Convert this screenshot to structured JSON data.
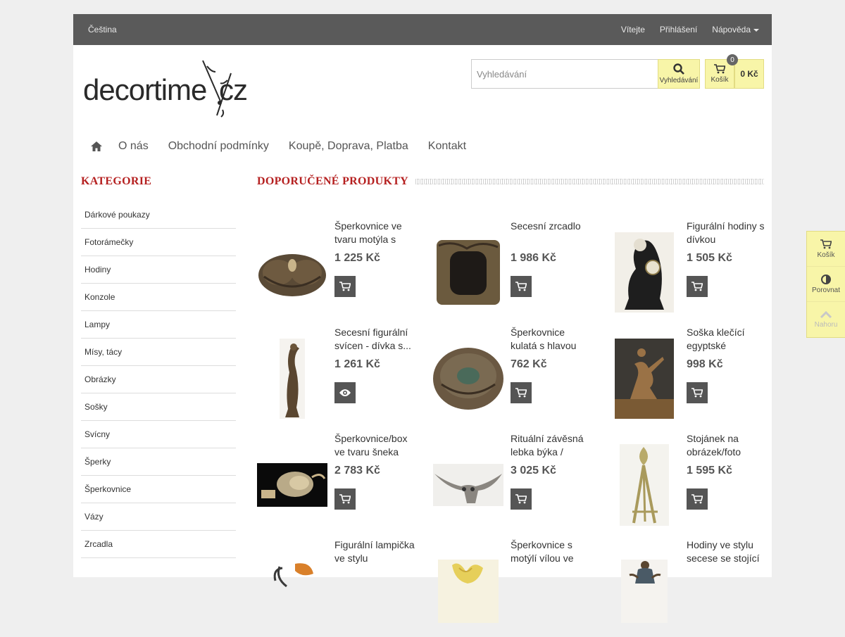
{
  "topbar": {
    "language": "Čeština",
    "welcome": "Vítejte",
    "login": "Přihlášení",
    "help": "Nápověda"
  },
  "logo": {
    "text": "decortime.cz"
  },
  "search": {
    "placeholder": "Vyhledávání",
    "button_label": "Vyhledávání"
  },
  "cart": {
    "label": "Košík",
    "count": "0",
    "total": "0 Kč"
  },
  "nav": {
    "items": [
      "O nás",
      "Obchodní podmínky",
      "Koupě, Doprava, Platba",
      "Kontakt"
    ]
  },
  "sidebar": {
    "title": "KATEGORIE",
    "items": [
      "Dárkové poukazy",
      "Fotorámečky",
      "Hodiny",
      "Konzole",
      "Lampy",
      "Mísy, tácy",
      "Obrázky",
      "Sošky",
      "Svícny",
      "Šperky",
      "Šperkovnice",
      "Vázy",
      "Zrcadla"
    ]
  },
  "main": {
    "title": "DOPORUČENÉ PRODUKTY",
    "products": [
      {
        "name": "Šperkovnice ve tvaru motýla s",
        "price": "1 225 Kč",
        "action": "cart-icon"
      },
      {
        "name": "Secesní zrcadlo",
        "price": "1 986 Kč",
        "action": "cart-icon"
      },
      {
        "name": "Figurální hodiny s dívkou",
        "price": "1 505 Kč",
        "action": "cart-icon"
      },
      {
        "name": "Secesní figurální svícen - dívka s...",
        "price": "1 261 Kč",
        "action": "eye-icon"
      },
      {
        "name": "Šperkovnice kulatá s hlavou",
        "price": "762 Kč",
        "action": "cart-icon"
      },
      {
        "name": "Soška klečící egyptské",
        "price": "998 Kč",
        "action": "cart-icon"
      },
      {
        "name": "Šperkovnice/box ve tvaru šneka",
        "price": "2 783 Kč",
        "action": "cart-icon"
      },
      {
        "name": "Rituální závěsná lebka býka /",
        "price": "3 025 Kč",
        "action": "cart-icon"
      },
      {
        "name": "Stojánek na obrázek/foto",
        "price": "1 595 Kč",
        "action": "cart-icon"
      },
      {
        "name": "Figurální lampička ve stylu",
        "price": "",
        "action": ""
      },
      {
        "name": "Šperkovnice s motýlí vílou ve",
        "price": "",
        "action": ""
      },
      {
        "name": "Hodiny ve stylu secese se stojící",
        "price": "",
        "action": ""
      }
    ]
  },
  "floatbar": {
    "cart": "Košík",
    "compare": "Porovnat",
    "top": "Nahoru"
  },
  "colors": {
    "accent_red": "#b52020",
    "topbar": "#5a5a5a",
    "yellow": "#f8f5a8"
  }
}
